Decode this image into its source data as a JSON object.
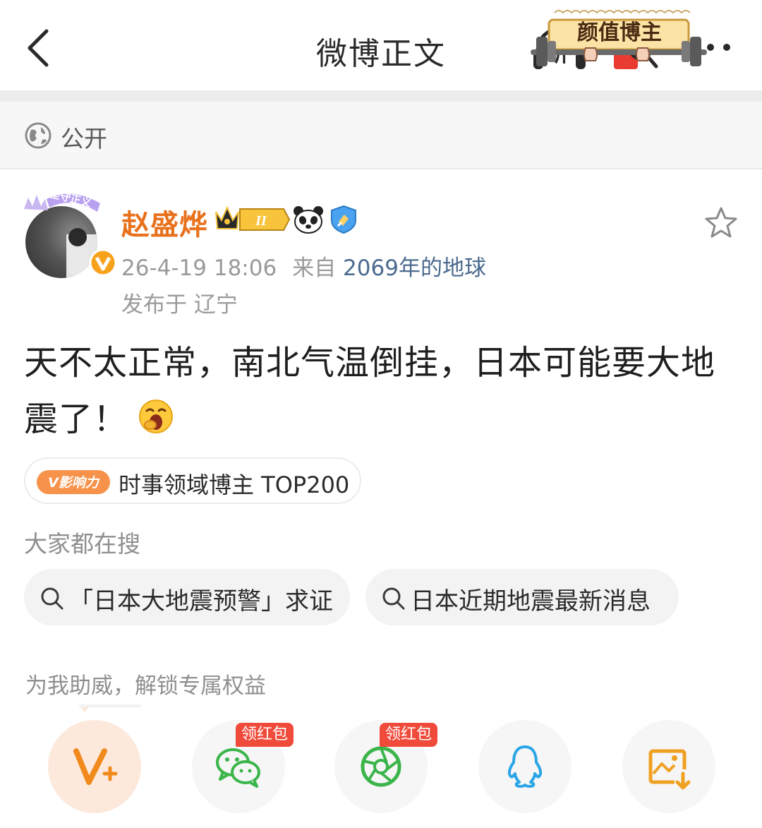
{
  "nav": {
    "title": "微博正文",
    "listen_label": "听"
  },
  "visibility": {
    "label": "公开",
    "badge_text": "颜值博主"
  },
  "post": {
    "author": "赵盛烨",
    "crown_level": "II",
    "timestamp": "26-4-19 18:06",
    "source_prefix": "来自",
    "source": "2069年的地球",
    "location": "发布于 辽宁",
    "body": "天不太正常，南北气温倒挂，日本可能要大地震了！",
    "avatar_frame_text": "坚守正义"
  },
  "influence": {
    "tag": "V影响力",
    "text": "时事领域博主 TOP200"
  },
  "search": {
    "label": "大家都在搜",
    "chips": [
      "「日本大地震预警」求证",
      "日本近期地震最新消息"
    ]
  },
  "support": {
    "label": "为我助威，解锁专属权益"
  },
  "share": {
    "redpack_tag": "领红包"
  },
  "colors": {
    "brand_orange": "#e8711c",
    "link_blue": "#4b6b8f",
    "redpack_red": "#f04a3a",
    "wechat_green": "#3bb54a",
    "qq_blue": "#2aa5e6"
  }
}
